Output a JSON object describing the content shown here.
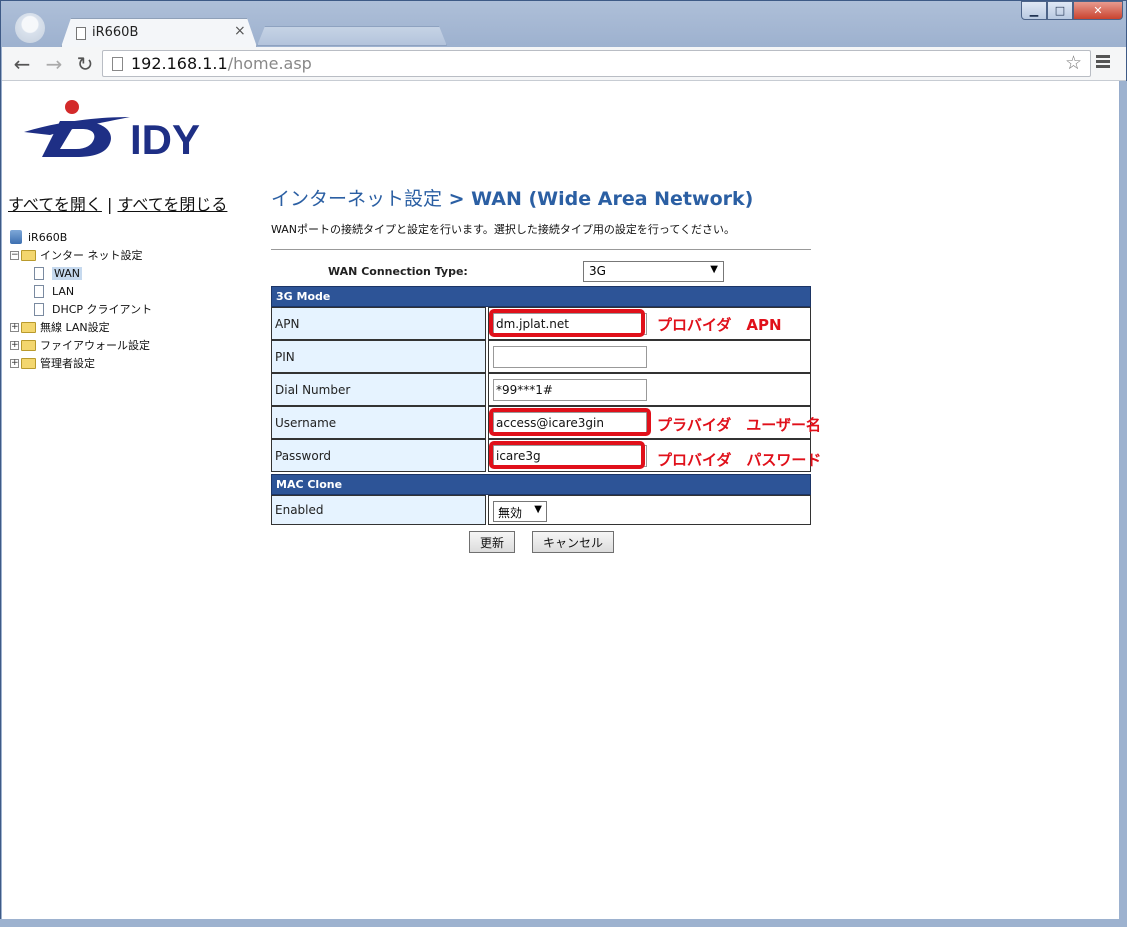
{
  "browser": {
    "tab_title": "iR660B",
    "tab_close": "×",
    "url_host": "192.168.1.1",
    "url_path": "/home.asp",
    "window_controls": {
      "minimize": "▁",
      "maximize": "□",
      "close": "✕"
    }
  },
  "logo": {
    "text": "IDY",
    "colors": [
      "#1e2f85",
      "#d32a2a"
    ]
  },
  "sidebar": {
    "expand_all": "すべてを開く",
    "separator": "|",
    "collapse_all": "すべてを閉じる",
    "tree": [
      {
        "label": "iR660B",
        "type": "root"
      },
      {
        "label": "インター ネット設定",
        "type": "folder",
        "toggle": "−"
      },
      {
        "label": "WAN",
        "type": "file",
        "selected": true
      },
      {
        "label": "LAN",
        "type": "file"
      },
      {
        "label": "DHCP クライアント",
        "type": "file"
      },
      {
        "label": "無線 LAN設定",
        "type": "folder",
        "toggle": "+"
      },
      {
        "label": "ファイアウォール設定",
        "type": "folder",
        "toggle": "+"
      },
      {
        "label": "管理者設定",
        "type": "folder",
        "toggle": "+"
      }
    ]
  },
  "main": {
    "title_prefix": "インターネット設定",
    "title_suffix": " > WAN (Wide Area Network)",
    "description": "WANポートの接続タイプと設定を行います。選択した接続タイプ用の設定を行ってください。",
    "connection_type_label": "WAN Connection Type:",
    "connection_type_value": "3G",
    "section_3g": "3G Mode",
    "fields": {
      "apn": {
        "label": "APN",
        "value": "dm.jplat.net",
        "note": "プロバイダ　APN"
      },
      "pin": {
        "label": "PIN",
        "value": ""
      },
      "dial": {
        "label": "Dial Number",
        "value": "*99***1#"
      },
      "username": {
        "label": "Username",
        "value": "access@icare3gin",
        "note": "プラバイダ　ユーザー名"
      },
      "password": {
        "label": "Password",
        "value": "icare3g",
        "note": "プロバイダ　パスワード"
      }
    },
    "section_mac": "MAC Clone",
    "enabled": {
      "label": "Enabled",
      "value": "無効"
    },
    "apply_button": "更新",
    "cancel_button": "キャンセル"
  },
  "colors": {
    "section_header": "#2d5497",
    "label_bg": "#e6f3ff",
    "title": "#2b5fa3",
    "annotation": "#e0101a"
  }
}
